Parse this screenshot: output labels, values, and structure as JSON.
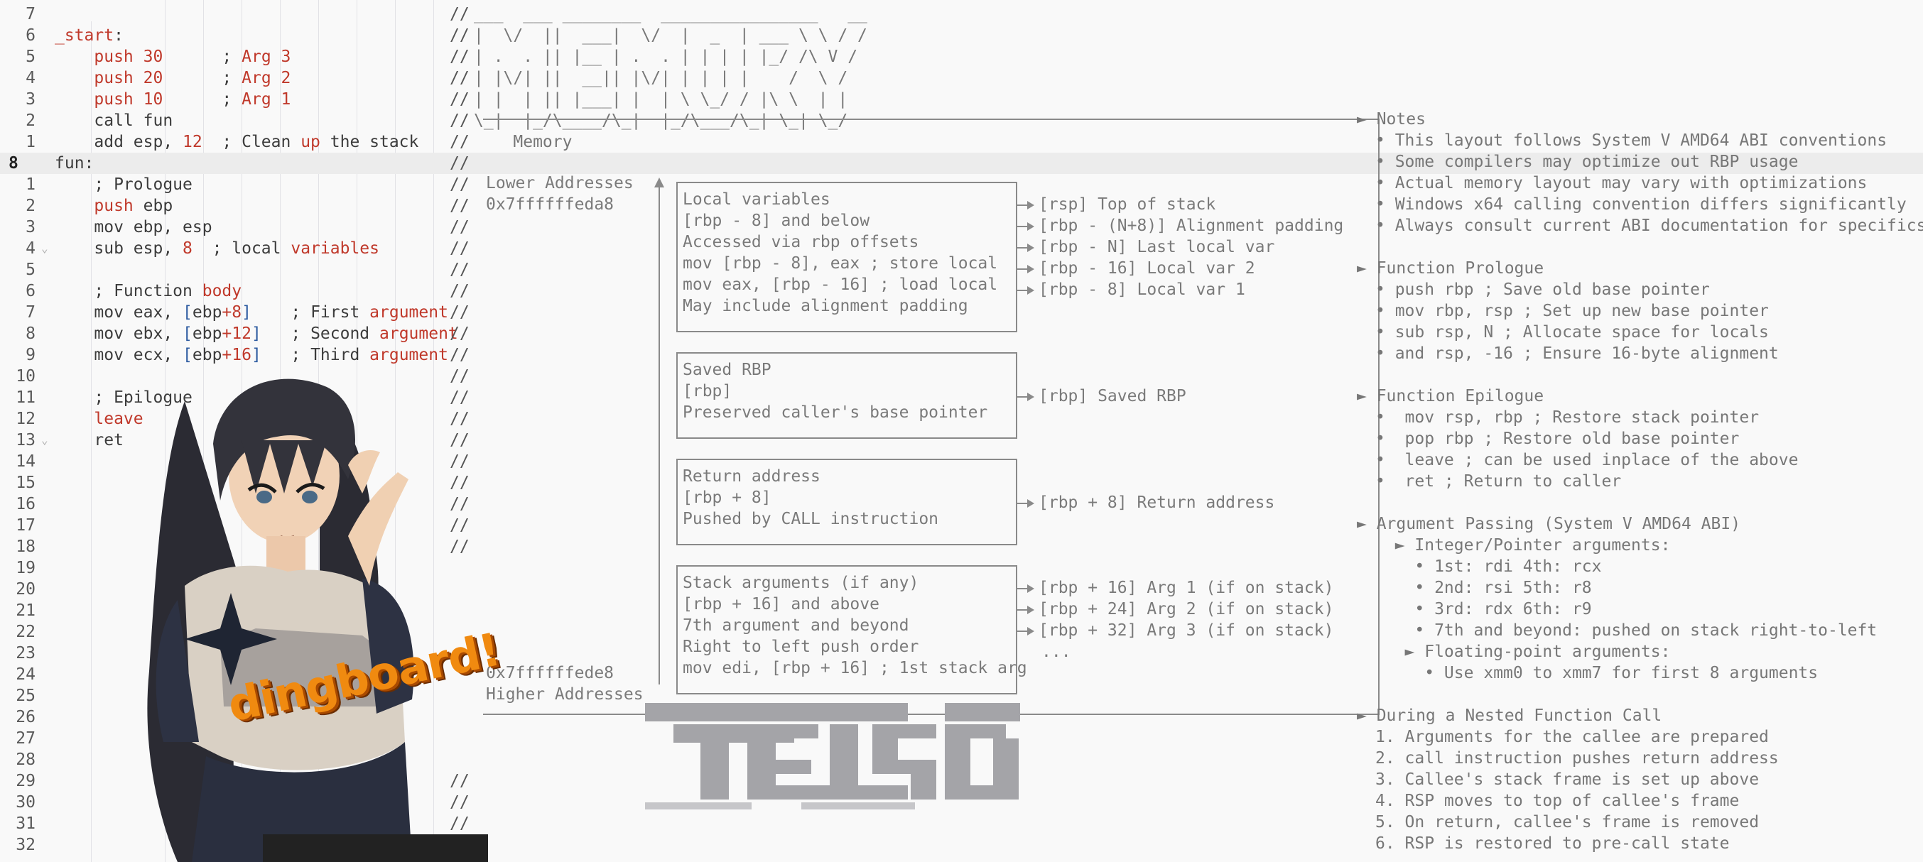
{
  "editor": {
    "current_line": "8",
    "lines": [
      {
        "ln": "7",
        "code": "",
        "cmt": "//",
        "art": "___  ___ ________  ________________   __"
      },
      {
        "ln": "6",
        "code": "_start:",
        "cmt": "//",
        "art": "|  \\/  ||  ___|  \\/  |  _  | ___ \\ \\ / /"
      },
      {
        "ln": "5",
        "code": "    push 30      ; Arg 3",
        "cmt": "//",
        "art": "| .  . || |__ | .  . | | | | |_/ /\\ V /"
      },
      {
        "ln": "4",
        "code": "    push 20      ; Arg 2",
        "cmt": "//",
        "art": "| |\\/| ||  __|| |\\/| | | | |    /  \\ /"
      },
      {
        "ln": "3",
        "code": "    push 10      ; Arg 1",
        "cmt": "//",
        "art": "| |  | || |___| |  | \\ \\_/ / |\\ \\  | |"
      },
      {
        "ln": "2",
        "code": "    call fun",
        "cmt": "//",
        "art": "\\_|  |_/\\____/\\_|  |_/\\___/\\_| \\_| \\_/"
      },
      {
        "ln": "1",
        "code": "    add esp, 12  ; Clean up the stack",
        "cmt": "//",
        "art": "    Memory"
      },
      {
        "ln": "8",
        "code": "fun:",
        "cmt": "//",
        "art": ""
      },
      {
        "ln": "1",
        "code": "    ; Prologue",
        "cmt": "//",
        "art": ""
      },
      {
        "ln": "2",
        "code": "    push ebp",
        "cmt": "//",
        "art": ""
      },
      {
        "ln": "3",
        "code": "    mov ebp, esp",
        "cmt": "//",
        "art": ""
      },
      {
        "ln": "4",
        "code": "    sub esp, 8  ; local variables",
        "cmt": "//",
        "art": ""
      },
      {
        "ln": "5",
        "code": "",
        "cmt": "//",
        "art": ""
      },
      {
        "ln": "6",
        "code": "    ; Function body",
        "cmt": "//",
        "art": ""
      },
      {
        "ln": "7",
        "code": "    mov eax, [ebp+8]    ; First argument",
        "cmt": "//",
        "art": ""
      },
      {
        "ln": "8",
        "code": "    mov ebx, [ebp+12]   ; Second argument",
        "cmt": "//",
        "art": ""
      },
      {
        "ln": "9",
        "code": "    mov ecx, [ebp+16]   ; Third argument",
        "cmt": "//",
        "art": ""
      },
      {
        "ln": "10",
        "code": "",
        "cmt": "//",
        "art": ""
      },
      {
        "ln": "11",
        "code": "    ; Epilogue",
        "cmt": "//",
        "art": ""
      },
      {
        "ln": "12",
        "code": "    leave",
        "cmt": "//",
        "art": ""
      },
      {
        "ln": "13",
        "code": "    ret",
        "cmt": "//",
        "art": ""
      },
      {
        "ln": "14",
        "code": "",
        "cmt": "//",
        "art": ""
      },
      {
        "ln": "15",
        "code": "",
        "cmt": "//",
        "art": ""
      },
      {
        "ln": "16",
        "code": "",
        "cmt": "//",
        "art": ""
      },
      {
        "ln": "17",
        "code": "",
        "cmt": "//",
        "art": ""
      },
      {
        "ln": "18",
        "code": "",
        "cmt": "//",
        "art": ""
      },
      {
        "ln": "19",
        "code": "",
        "cmt": "",
        "art": ""
      },
      {
        "ln": "20",
        "code": "",
        "cmt": "",
        "art": ""
      },
      {
        "ln": "21",
        "code": "",
        "cmt": "",
        "art": ""
      },
      {
        "ln": "22",
        "code": "",
        "cmt": "",
        "art": ""
      },
      {
        "ln": "23",
        "code": "",
        "cmt": "",
        "art": ""
      },
      {
        "ln": "24",
        "code": "",
        "cmt": "",
        "art": ""
      },
      {
        "ln": "25",
        "code": "",
        "cmt": "",
        "art": ""
      },
      {
        "ln": "26",
        "code": "",
        "cmt": "",
        "art": ""
      },
      {
        "ln": "27",
        "code": "",
        "cmt": "",
        "art": ""
      },
      {
        "ln": "28",
        "code": "",
        "cmt": "",
        "art": ""
      },
      {
        "ln": "29",
        "code": "",
        "cmt": "//",
        "art": ""
      },
      {
        "ln": "30",
        "code": "",
        "cmt": "//",
        "art": ""
      },
      {
        "ln": "31",
        "code": "",
        "cmt": "//",
        "art": ""
      },
      {
        "ln": "32",
        "code": "",
        "cmt": "",
        "art": ""
      }
    ]
  },
  "memory": {
    "lower_label": "Lower Addresses",
    "lower_addr": "0x7ffffffeda8",
    "higher_addr": "0x7ffffffede8",
    "higher_label": "Higher Addresses",
    "boxes": [
      {
        "lines": [
          "Local variables",
          "[rbp - 8] and below",
          "Accessed via rbp offsets",
          "mov [rbp - 8], eax ; store local",
          "mov eax, [rbp - 16] ; load local",
          "May include alignment padding"
        ]
      },
      {
        "lines": [
          "Saved RBP",
          "[rbp]",
          "Preserved caller's base pointer"
        ]
      },
      {
        "lines": [
          "Return address",
          "[rbp + 8]",
          "Pushed by CALL instruction"
        ]
      },
      {
        "lines": [
          "Stack arguments (if any)",
          "[rbp + 16] and above",
          "7th argument and beyond",
          "Right to left push order",
          "mov edi, [rbp + 16] ; 1st stack arg"
        ]
      }
    ],
    "pointers": [
      "[rsp] Top of stack",
      "[rbp - (N+8)] Alignment padding",
      "[rbp - N] Last local var",
      "[rbp - 16] Local var 2",
      "[rbp - 8] Local var 1",
      "[rbp] Saved RBP",
      "[rbp + 8] Return address",
      "[rbp + 16] Arg 1 (if on stack)",
      "[rbp + 24] Arg 2 (if on stack)",
      "[rbp + 32] Arg 3 (if on stack)",
      "..."
    ]
  },
  "notes": {
    "sections": [
      {
        "title": "► Notes",
        "items": [
          "• This layout follows System V AMD64 ABI conventions",
          "• Some compilers may optimize out RBP usage",
          "• Actual memory layout may vary with optimizations",
          "• Windows x64 calling convention differs significantly",
          "• Always consult current ABI documentation for specifics"
        ]
      },
      {
        "title": "► Function Prologue",
        "items": [
          "• push rbp ; Save old base pointer",
          "• mov rbp, rsp ; Set up new base pointer",
          "• sub rsp, N ; Allocate space for locals",
          "• and rsp, -16 ; Ensure 16-byte alignment"
        ]
      },
      {
        "title": "► Function Epilogue",
        "items": [
          "•  mov rsp, rbp ; Restore stack pointer",
          "•  pop rbp ; Restore old base pointer",
          "•  leave ; can be used inplace of the above",
          "•  ret ; Return to caller"
        ]
      },
      {
        "title": "► Argument Passing (System V AMD64 ABI)",
        "items": [
          "  ► Integer/Pointer arguments:",
          "    • 1st: rdi 4th: rcx",
          "    • 2nd: rsi 5th: r8",
          "    • 3rd: rdx 6th: r9",
          "    • 7th and beyond: pushed on stack right-to-left",
          "   ► Floating-point arguments:",
          "     • Use xmm0 to xmm7 for first 8 arguments"
        ]
      },
      {
        "title": "► During a Nested Function Call",
        "items": [
          "1. Arguments for the callee are prepared",
          "2. call instruction pushes return address",
          "3. Callee's stack frame is set up above",
          "4. RSP moves to top of callee's frame",
          "5. On return, callee's frame is removed",
          "6. RSP is restored to pre-call state"
        ]
      }
    ]
  },
  "overlay": {
    "logo_text": "dingboard!",
    "image_name": "anime-character-image"
  },
  "colors": {
    "accent_red": "#c0392b",
    "accent_blue": "#2c5aa0",
    "background": "#f9f9f9",
    "current_line_bg": "#ececec"
  }
}
